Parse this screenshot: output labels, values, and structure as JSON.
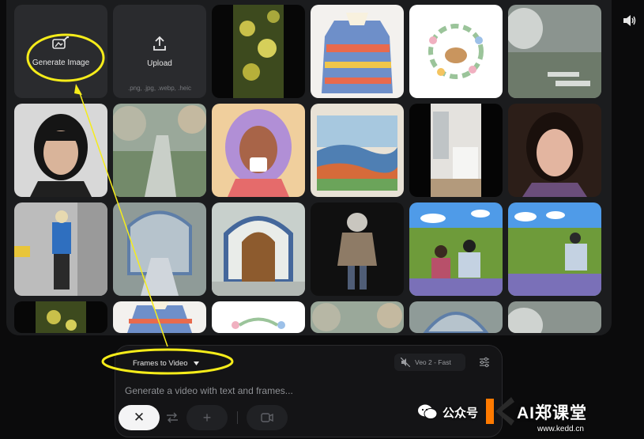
{
  "gallery": {
    "generate_tile": {
      "label": "Generate Image",
      "icon": "generate-image-icon"
    },
    "upload_tile": {
      "label": "Upload",
      "icon": "upload-icon",
      "formats": ".png, .jpg, .webp, .heic"
    }
  },
  "header": {
    "audio_icon": "speaker-icon"
  },
  "composer": {
    "mode_label": "Frames to Video",
    "model_label": "Veo 2 - Fast",
    "prompt_placeholder": "Generate a video with text and frames...",
    "close_glyph": "✕",
    "add_glyph": "+"
  },
  "watermark": {
    "wechat_text": "公众号",
    "brand_text": "AI郑课堂",
    "url_text": "www.kedd.cn"
  },
  "colors": {
    "background": "#0b0b0c",
    "panel": "#1b1c1e",
    "tile": "#2a2b2e",
    "annotation_yellow": "#f5ec1a",
    "brand_orange": "#ff7a00"
  }
}
